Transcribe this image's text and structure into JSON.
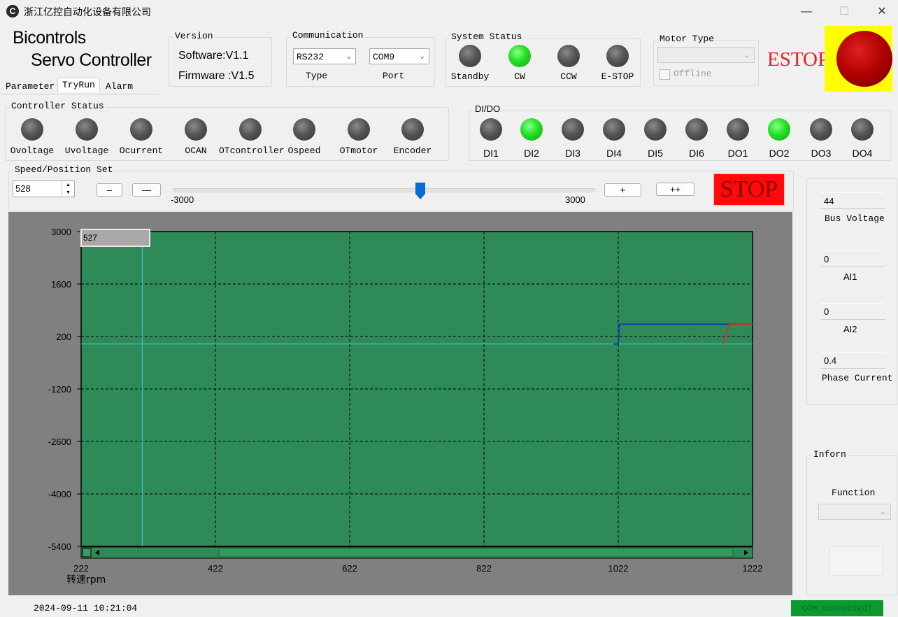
{
  "window": {
    "title": "浙江亿控自动化设备有限公司",
    "icon": "app-logo-icon",
    "controls": [
      "minimize-icon",
      "maximize-icon",
      "close-icon"
    ],
    "minimize": "—",
    "maximize": "☐",
    "close": "✕"
  },
  "brand": {
    "line1": "Bicontrols",
    "line2": "Servo Controller"
  },
  "tabs": [
    "Parameter",
    "TryRun",
    "Alarm"
  ],
  "version": {
    "title": "Version",
    "software": "Software:V1.1",
    "firmware": "Firmware :V1.5"
  },
  "communication": {
    "title": "Communication",
    "type_value": "RS232",
    "type_label": "Type",
    "port_value": "COM9",
    "port_label": "Port"
  },
  "system_status": {
    "title": "System Status",
    "indicators": [
      {
        "label": "Standby",
        "on": false
      },
      {
        "label": "CW",
        "on": true
      },
      {
        "label": "CCW",
        "on": false
      },
      {
        "label": "E-STOP",
        "on": false
      }
    ]
  },
  "motor_type": {
    "title": "Motor Type",
    "value": "",
    "offline_label": "Offline",
    "offline_checked": false
  },
  "estop": {
    "label": "ESTOP",
    "color": "#e8202a",
    "button_color": "#b00000",
    "frame_color": "#ffff00"
  },
  "controller_status": {
    "title": "Controller Status",
    "indicators": [
      {
        "label": "Ovoltage",
        "on": false
      },
      {
        "label": "Uvoltage",
        "on": false
      },
      {
        "label": "Ocurrent",
        "on": false
      },
      {
        "label": "OCAN",
        "on": false
      },
      {
        "label": "OTcontroller",
        "on": false
      },
      {
        "label": "Ospeed",
        "on": false
      },
      {
        "label": "OTmotor",
        "on": false
      },
      {
        "label": "Encoder",
        "on": false
      }
    ]
  },
  "dido": {
    "title": "DI/DO",
    "indicators": [
      {
        "label": "DI1",
        "on": false
      },
      {
        "label": "DI2",
        "on": true
      },
      {
        "label": "DI3",
        "on": false
      },
      {
        "label": "DI4",
        "on": false
      },
      {
        "label": "DI5",
        "on": false
      },
      {
        "label": "DI6",
        "on": false
      },
      {
        "label": "DO1",
        "on": false
      },
      {
        "label": "DO2",
        "on": true
      },
      {
        "label": "DO3",
        "on": false
      },
      {
        "label": "DO4",
        "on": false
      }
    ]
  },
  "speed_set": {
    "title": "Speed/Position Set",
    "value": "528",
    "btn_minus": "–",
    "btn_minus2": "—",
    "btn_plus": "+",
    "btn_plus2": "++",
    "slider_min": "-3000",
    "slider_max": "3000",
    "slider_value": 528,
    "stop_label": "STOP"
  },
  "readouts": [
    {
      "value": "44",
      "label": "Bus Voltage"
    },
    {
      "value": "0",
      "label": "AI1"
    },
    {
      "value": "0",
      "label": "AI2"
    },
    {
      "value": "0.4",
      "label": "Phase Current"
    }
  ],
  "inforn": {
    "title": "Inforn",
    "function_label": "Function",
    "function_value": ""
  },
  "status_bar": {
    "datetime": "2024-09-11  10:21:04",
    "connection": "COM connected!",
    "connection_color": "#0c9a2e"
  },
  "chart_data": {
    "type": "line",
    "title": "",
    "xlabel": "转速rpm",
    "ylabel": "",
    "xlim": [
      222,
      1222
    ],
    "ylim": [
      -5400,
      3000
    ],
    "x_ticks": [
      "222",
      "422",
      "622",
      "822",
      "1022",
      "1222"
    ],
    "y_ticks": [
      "3000",
      "1600",
      "200",
      "-1200",
      "-2600",
      "-4000",
      "-5400"
    ],
    "grid": true,
    "background": "#2e8b57",
    "cursor_value": "527",
    "cursor_x": 313,
    "cursor_y": 0,
    "series": [
      {
        "color": "#1a3fa8",
        "x": [
          1015,
          1022,
          1024,
          1222
        ],
        "y": [
          0,
          0,
          530,
          530
        ]
      },
      {
        "color": "#c0392b",
        "x": [
          1178,
          1184,
          1188,
          1222
        ],
        "y": [
          0,
          350,
          520,
          530
        ]
      }
    ]
  }
}
